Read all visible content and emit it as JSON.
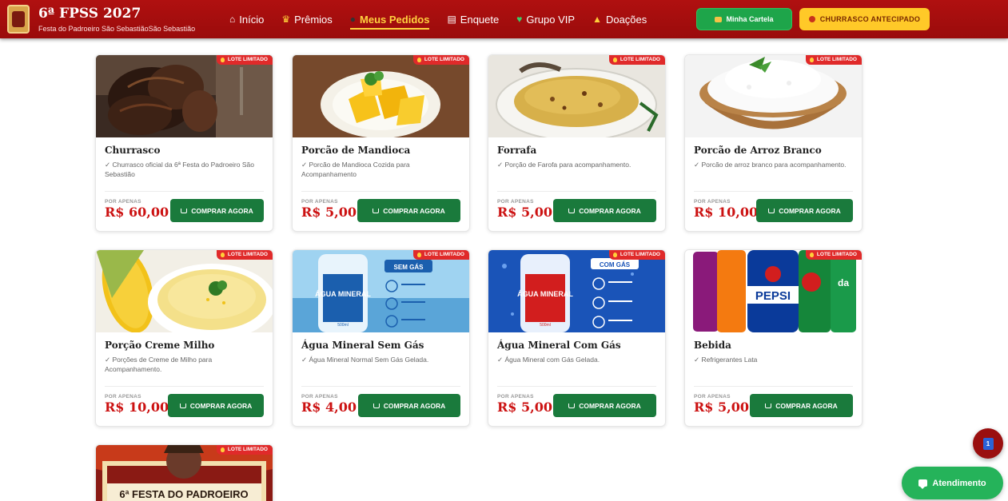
{
  "header": {
    "title": "6ª FPSS 2027",
    "subtitle": "Festa do Padroeiro São SebastiãoSão Sebastião",
    "nav": [
      {
        "label": "Início",
        "icon": "home-icon"
      },
      {
        "label": "Prêmios",
        "icon": "trophy-icon"
      },
      {
        "label": "Meus Pedidos",
        "icon": "orders-icon",
        "active": true
      },
      {
        "label": "Enquete",
        "icon": "poll-icon"
      },
      {
        "label": "Grupo VIP",
        "icon": "heart-icon"
      },
      {
        "label": "Doações",
        "icon": "praying-hands-icon"
      }
    ],
    "cartela_label": "Minha Cartela",
    "churrasco_label": "CHURRASCO ANTECIPADO"
  },
  "badge_label": "LOTE LIMITADO",
  "price_prefix": "POR APENAS",
  "buy_label": "COMPRAR AGORA",
  "products": [
    {
      "title": "Churrasco",
      "desc": "✓ Churrasco oficial da 6ª Festa do Padroeiro São Sebastião",
      "price": "R$ 60,00"
    },
    {
      "title": "Porcão de Mandioca",
      "desc": "✓ Porcão de Mandioca Cozida para Acompanhamento",
      "price": "R$ 5,00"
    },
    {
      "title": "Forrafa",
      "desc": "✓ Porção de Farofa para acompanhamento.",
      "price": "R$ 5,00"
    },
    {
      "title": "Porcão de Arroz Branco",
      "desc": "✓ Porcão de arroz branco para acompanhamento.",
      "price": "R$ 10,00"
    },
    {
      "title": "Porção Creme Milho",
      "desc": "✓ Porções de Creme de Milho para Acompanhamento.",
      "price": "R$ 10,00"
    },
    {
      "title": "Água Mineral Sem Gás",
      "desc": "✓ Água Mineral Normal Sem Gás Gelada.",
      "price": "R$ 4,00"
    },
    {
      "title": "Água Mineral Com Gás",
      "desc": "✓ Água Mineral com Gás Gelada.",
      "price": "R$ 5,00"
    },
    {
      "title": "Bebida",
      "desc": "✓ Refrigerantes Lata",
      "price": "R$ 5,00"
    }
  ],
  "image_texts": {
    "water_brand": "ÁGUA MINERAL",
    "sem_gas": "SEM GÁS",
    "com_gas": "COM GÁS",
    "volume": "500ml",
    "pepsi": "PEPSI",
    "poster": "6ª FESTA DO PADROEIRO"
  },
  "floating": {
    "notification_count": "1",
    "atendimento_label": "Atendimento"
  },
  "colors": {
    "header_red": "#a50e0e",
    "active_yellow": "#ffd23f",
    "buy_green": "#1a7a3c",
    "price_red": "#cc1212",
    "badge_red": "#e02a2a"
  }
}
